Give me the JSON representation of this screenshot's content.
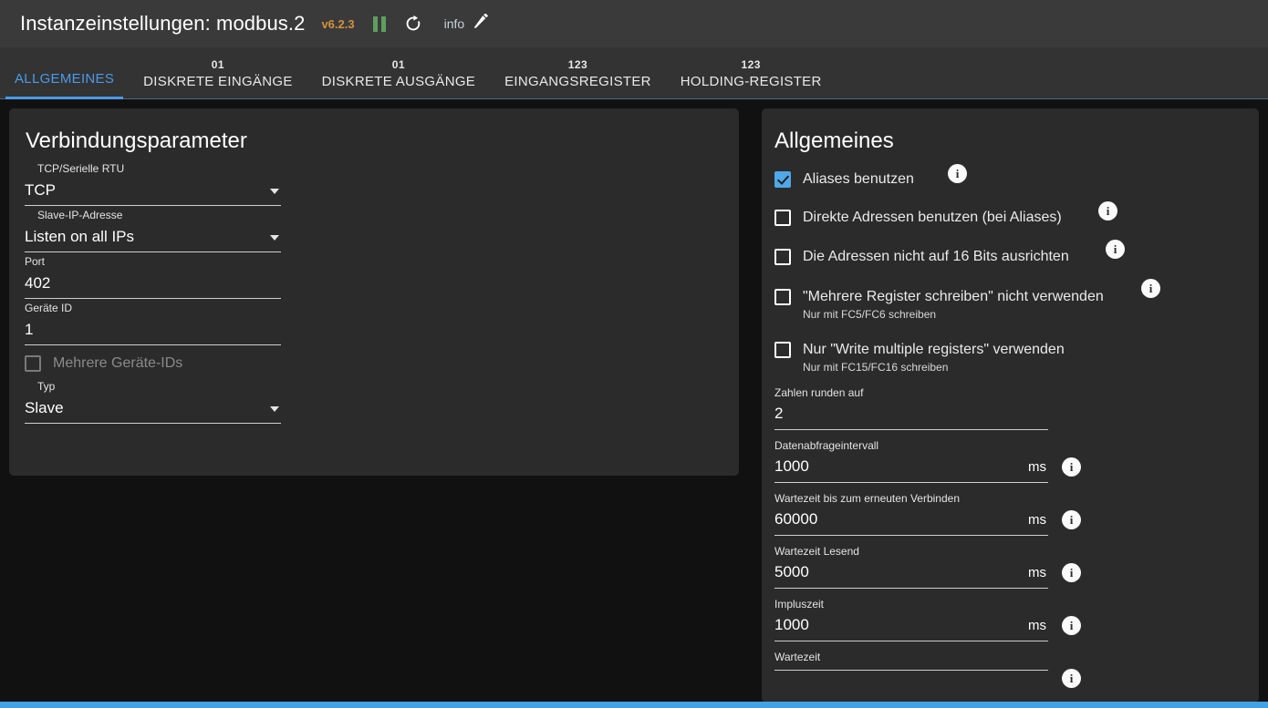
{
  "header": {
    "title": "Instanzeinstellungen: modbus.2",
    "version": "v6.2.3",
    "info_label": "info",
    "icons": {
      "pause": "pause-icon",
      "refresh": "refresh-icon",
      "edit": "pencil-icon"
    },
    "colors": {
      "version": "#d4913c",
      "pause": "#5f9e5f",
      "accent": "#4a9ae8"
    }
  },
  "tabs": [
    {
      "glyph": "",
      "label": "ALLGEMEINES",
      "active": true
    },
    {
      "glyph": "01",
      "label": "DISKRETE EINGÄNGE",
      "active": false
    },
    {
      "glyph": "01",
      "label": "DISKRETE AUSGÄNGE",
      "active": false
    },
    {
      "glyph": "123",
      "label": "EINGANGSREGISTER",
      "active": false
    },
    {
      "glyph": "123",
      "label": "HOLDING-REGISTER",
      "active": false
    }
  ],
  "left": {
    "heading": "Verbindungsparameter",
    "protocol": {
      "label": "TCP/Serielle RTU",
      "value": "TCP"
    },
    "slave_ip": {
      "label": "Slave-IP-Adresse",
      "value": "Listen on all IPs"
    },
    "port": {
      "label": "Port",
      "value": "402"
    },
    "device_id": {
      "label": "Geräte ID",
      "value": "1"
    },
    "multi_ids": {
      "label": "Mehrere Geräte-IDs",
      "checked": false,
      "disabled": true
    },
    "type": {
      "label": "Typ",
      "value": "Slave"
    }
  },
  "right": {
    "heading": "Allgemeines",
    "checkboxes": [
      {
        "label": "Aliases benutzen",
        "sub": "",
        "checked": true,
        "info": true
      },
      {
        "label": "Direkte Adressen benutzen (bei Aliases)",
        "sub": "",
        "checked": false,
        "info": true
      },
      {
        "label": "Die Adressen nicht auf 16 Bits ausrichten",
        "sub": "",
        "checked": false,
        "info": true
      },
      {
        "label": "\"Mehrere Register schreiben\" nicht verwenden",
        "sub": "Nur mit FC5/FC6 schreiben",
        "checked": false,
        "info": true
      },
      {
        "label": "Nur \"Write multiple registers\" verwenden",
        "sub": "Nur mit FC15/FC16 schreiben",
        "checked": false,
        "info": false
      }
    ],
    "fields": [
      {
        "label": "Zahlen runden auf",
        "value": "2",
        "unit": "",
        "info": false
      },
      {
        "label": "Datenabfrageintervall",
        "value": "1000",
        "unit": "ms",
        "info": true
      },
      {
        "label": "Wartezeit bis zum erneuten Verbinden",
        "value": "60000",
        "unit": "ms",
        "info": true
      },
      {
        "label": "Wartezeit Lesend",
        "value": "5000",
        "unit": "ms",
        "info": true
      },
      {
        "label": "Impluszeit",
        "value": "1000",
        "unit": "ms",
        "info": true
      },
      {
        "label": "Wartezeit",
        "value": "",
        "unit": "",
        "info": true
      }
    ]
  }
}
